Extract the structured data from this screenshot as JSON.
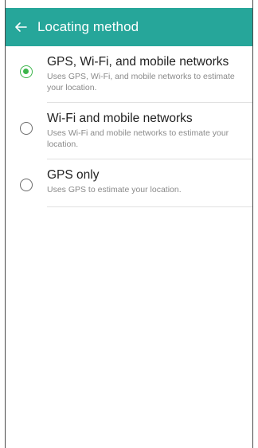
{
  "header": {
    "title": "Locating method",
    "back_icon": "arrow-left-icon"
  },
  "colors": {
    "app_bar": "#26a69a",
    "radio_checked": "#3bb54a"
  },
  "options": [
    {
      "title": "GPS, Wi-Fi, and mobile networks",
      "description": "Uses GPS, Wi-Fi, and mobile networks to estimate your location.",
      "selected": true
    },
    {
      "title": "Wi-Fi and mobile networks",
      "description": "Uses Wi-Fi and mobile networks to estimate your location.",
      "selected": false
    },
    {
      "title": "GPS only",
      "description": "Uses GPS to estimate your location.",
      "selected": false
    }
  ]
}
